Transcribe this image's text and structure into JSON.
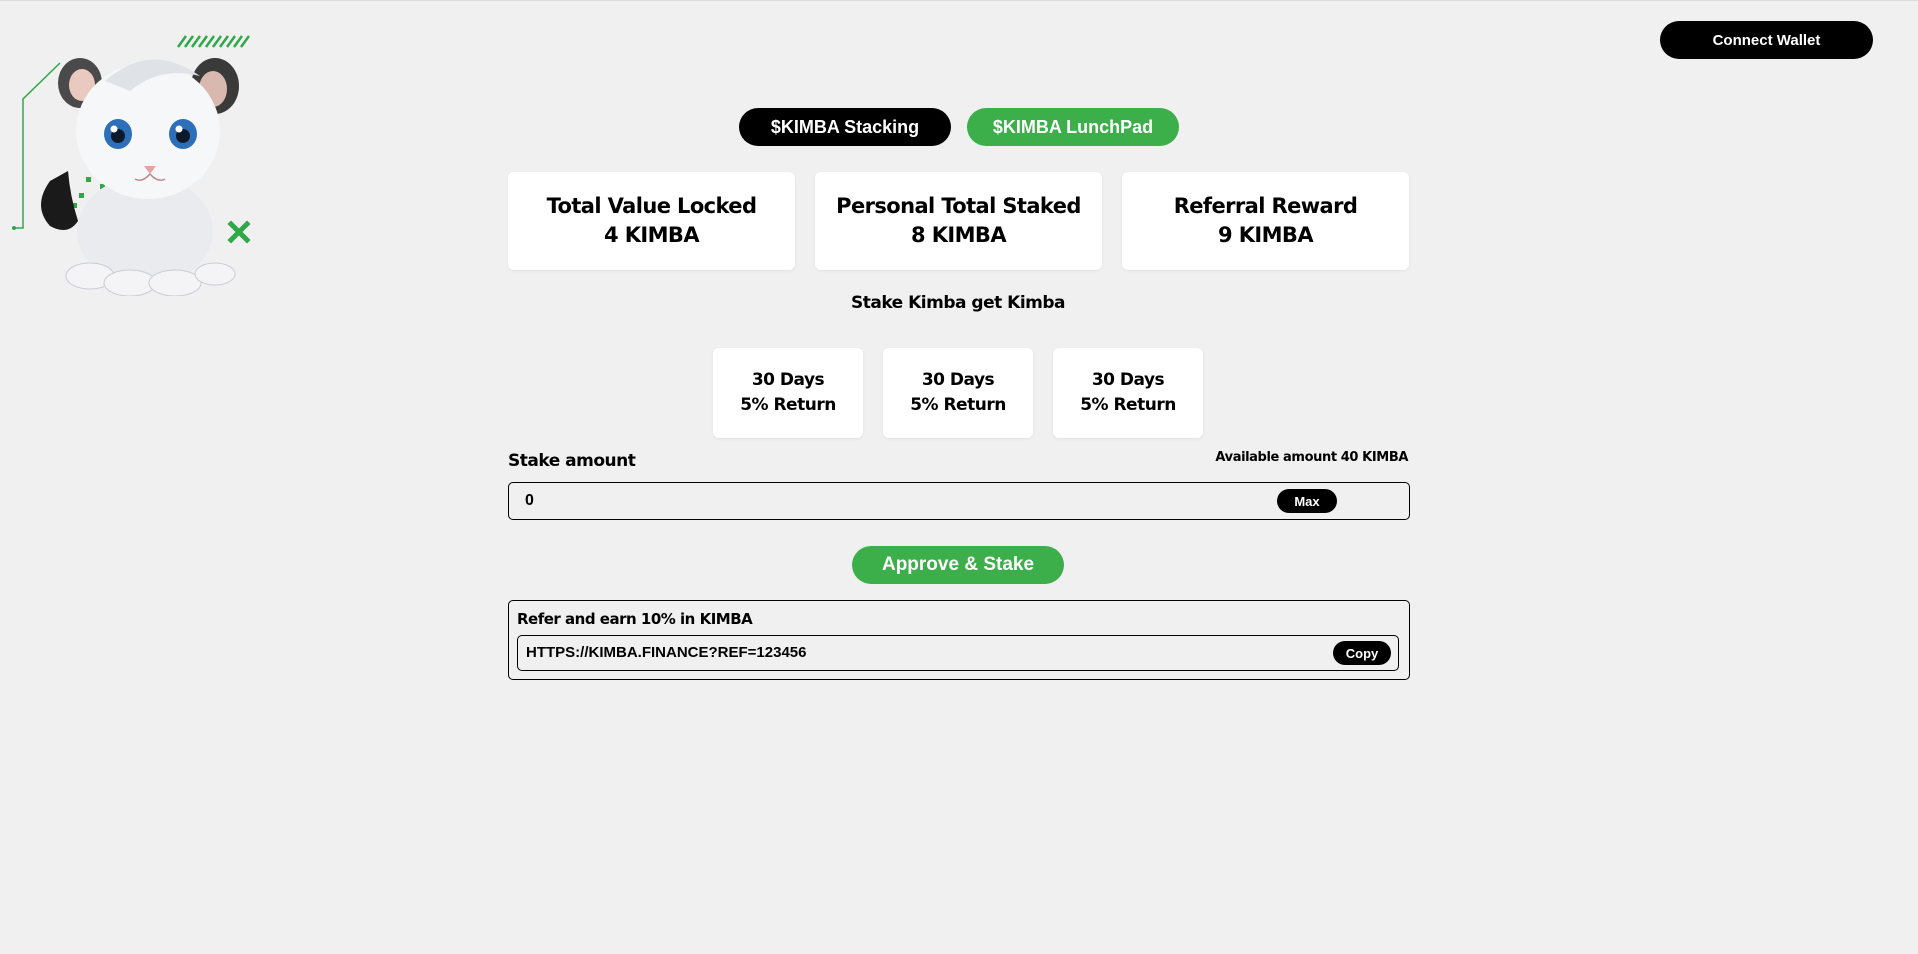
{
  "header": {
    "logo_icon": "white-lion-cub-mascot-icon",
    "connect_wallet_label": "Connect Wallet"
  },
  "tabs": [
    {
      "label": "$KIMBA Stacking",
      "color": "#000000"
    },
    {
      "label": "$KIMBA LunchPad",
      "color": "#3cae4a"
    }
  ],
  "stats": [
    {
      "title": "Total Value Locked",
      "value": "4 KIMBA"
    },
    {
      "title": "Personal Total Staked",
      "value": "8 KIMBA"
    },
    {
      "title": "Referral Reward",
      "value": "9 KIMBA"
    }
  ],
  "subtitle": "Stake Kimba get Kimba",
  "plans": [
    {
      "days": "30 Days",
      "return": "5% Return"
    },
    {
      "days": "30 Days",
      "return": "5% Return"
    },
    {
      "days": "30 Days",
      "return": "5% Return"
    }
  ],
  "stake": {
    "label": "Stake amount",
    "available": "Available amount 40 KIMBA",
    "value": "0",
    "max_label": "Max",
    "approve_label": "Approve & Stake"
  },
  "referral": {
    "title": "Refer and earn 10% in KIMBA",
    "link": "HTTPS://KIMBA.FINANCE?REF=123456",
    "copy_label": "Copy"
  },
  "colors": {
    "background": "#f0f0f0",
    "accent_green": "#3cae4a",
    "dark": "#000000"
  }
}
